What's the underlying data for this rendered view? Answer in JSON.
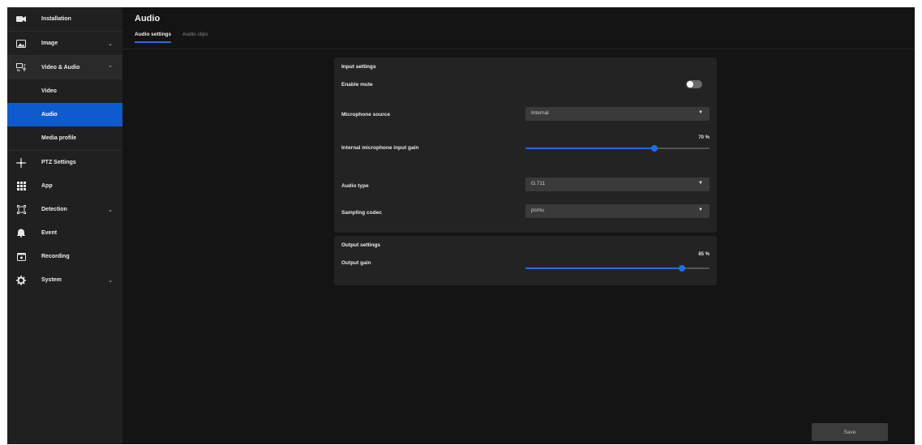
{
  "sidebar": {
    "items": [
      {
        "label": "Installation",
        "icon": "camera-icon"
      },
      {
        "label": "Image",
        "icon": "image-icon"
      },
      {
        "label": "Video & Audio",
        "icon": "video-audio-icon"
      },
      {
        "label": "PTZ Settings",
        "icon": "ptz-icon"
      },
      {
        "label": "App",
        "icon": "app-grid-icon"
      },
      {
        "label": "Detection",
        "icon": "detection-icon"
      },
      {
        "label": "Event",
        "icon": "bell-icon"
      },
      {
        "label": "Recording",
        "icon": "recording-icon"
      },
      {
        "label": "System",
        "icon": "gear-icon"
      }
    ],
    "sub_items": [
      {
        "label": "Video"
      },
      {
        "label": "Audio",
        "active": true
      },
      {
        "label": "Media profile"
      }
    ]
  },
  "page": {
    "title": "Audio",
    "tabs": [
      {
        "label": "Audio settings",
        "active": true
      },
      {
        "label": "Audio clips",
        "active": false
      }
    ]
  },
  "input_settings": {
    "title": "Input settings",
    "enable_mute_label": "Enable mute",
    "enable_mute": false,
    "microphone_source_label": "Microphone source",
    "microphone_source": "Internal",
    "mic_gain_label": "Internal microphone input gain",
    "mic_gain_display": "70 %",
    "mic_gain_value": 70,
    "audio_type_label": "Audio type",
    "audio_type": "G.711",
    "sampling_codec_label": "Sampling codec",
    "sampling_codec": "pcmu"
  },
  "output_settings": {
    "title": "Output settings",
    "output_gain_label": "Output gain",
    "output_gain_display": "85 %",
    "output_gain_value": 85
  },
  "footer": {
    "save_label": "Save"
  },
  "colors": {
    "accent": "#1e6ee8",
    "active_nav": "#0e5bd0",
    "background": "#141414",
    "sidebar": "#202020",
    "card": "#232323"
  }
}
